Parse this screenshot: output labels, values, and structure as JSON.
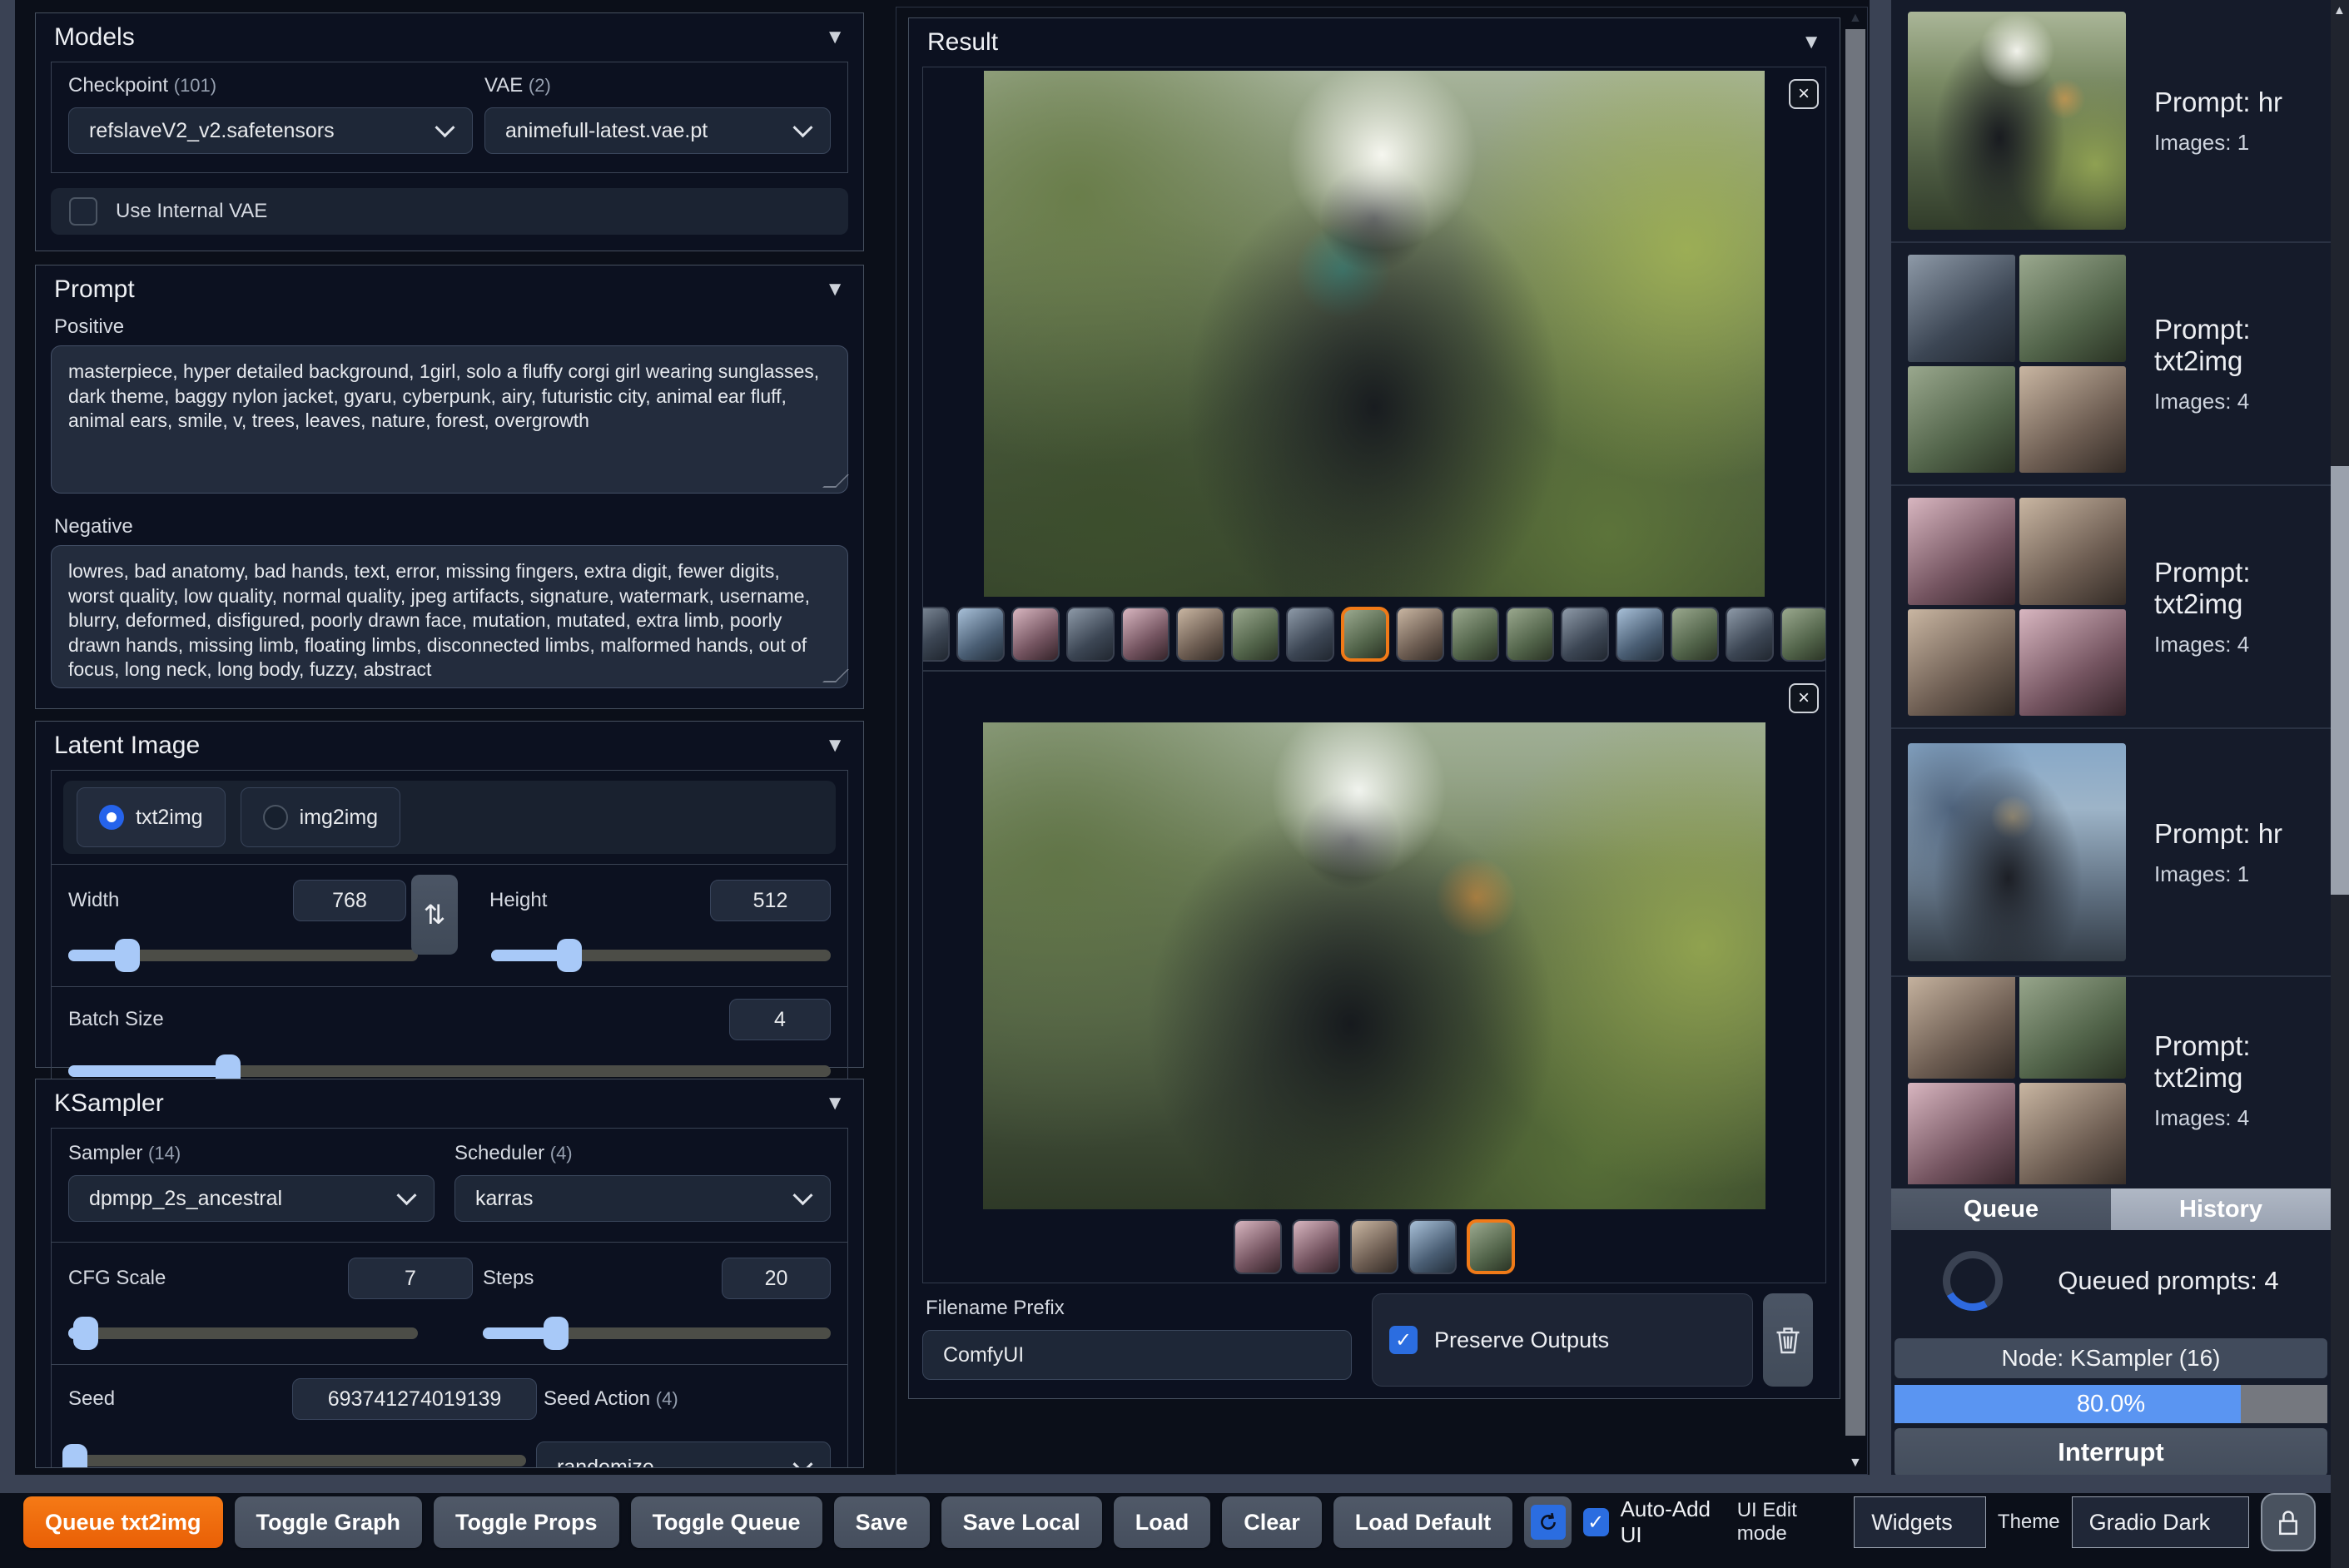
{
  "icons": {
    "collapse": "▼",
    "close": "×",
    "swap": "⇅",
    "check": "✓",
    "up_arrow": "▲",
    "down_arrow": "▼"
  },
  "colors": {
    "accent_orange": "#f07a18",
    "accent_blue": "#2b6de0",
    "slider_blue": "#a8c9f8",
    "progress_blue": "#5a95f2"
  },
  "left_panel": {
    "models": {
      "title": "Models",
      "checkpoint_label": "Checkpoint",
      "checkpoint_count": "(101)",
      "checkpoint_value": "refslaveV2_v2.safetensors",
      "vae_label": "VAE",
      "vae_count": "(2)",
      "vae_value": "animefull-latest.vae.pt",
      "use_internal_vae_label": "Use Internal VAE",
      "use_internal_vae_checked": false
    },
    "prompt": {
      "title": "Prompt",
      "positive_label": "Positive",
      "positive_value": "masterpiece, hyper detailed background, 1girl, solo a fluffy corgi girl wearing sunglasses, dark theme, baggy nylon jacket, gyaru, cyberpunk, airy, futuristic city, animal ear fluff, animal ears, smile, v, trees, leaves, nature, forest, overgrowth",
      "negative_label": "Negative",
      "negative_value": "lowres, bad anatomy, bad hands, text, error, missing fingers, extra digit, fewer digits, worst quality, low quality, normal quality, jpeg artifacts, signature, watermark, username, blurry, deformed, disfigured, poorly drawn face, mutation, mutated, extra limb, poorly drawn hands, missing limb, floating limbs, disconnected limbs, malformed hands, out of focus, long neck, long body, fuzzy, abstract"
    },
    "latent": {
      "title": "Latent Image",
      "mode_txt2img": "txt2img",
      "mode_img2img": "img2img",
      "mode_selected": "txt2img",
      "width_label": "Width",
      "width_value": "768",
      "height_label": "Height",
      "height_value": "512",
      "batch_label": "Batch Size",
      "batch_value": "4"
    },
    "ksampler": {
      "title": "KSampler",
      "sampler_label": "Sampler",
      "sampler_count": "(14)",
      "sampler_value": "dpmpp_2s_ancestral",
      "scheduler_label": "Scheduler",
      "scheduler_count": "(4)",
      "scheduler_value": "karras",
      "cfg_label": "CFG Scale",
      "cfg_value": "7",
      "steps_label": "Steps",
      "steps_value": "20",
      "seed_label": "Seed",
      "seed_value": "693741274019139",
      "seed_action_label": "Seed Action",
      "seed_action_count": "(4)",
      "seed_action_value": "randomize"
    }
  },
  "result_panel": {
    "title": "Result",
    "gallery1_thumb_count": 18,
    "gallery1_selected_index": 8,
    "gallery2_thumb_count": 5,
    "gallery2_selected_index": 4,
    "filename_prefix_label": "Filename Prefix",
    "filename_prefix_value": "ComfyUI",
    "preserve_outputs_label": "Preserve Outputs",
    "preserve_outputs_checked": true
  },
  "sidebar": {
    "items": [
      {
        "prompt": "Prompt: hr",
        "images": "Images: 1"
      },
      {
        "prompt": "Prompt: txt2img",
        "images": "Images: 4"
      },
      {
        "prompt": "Prompt: txt2img",
        "images": "Images: 4"
      },
      {
        "prompt": "Prompt: hr",
        "images": "Images: 1"
      },
      {
        "prompt": "Prompt: txt2img",
        "images": "Images: 4"
      }
    ],
    "tabs": {
      "queue_label": "Queue",
      "history_label": "History",
      "selected": "History"
    },
    "queued_text": "Queued prompts: 4",
    "node_text": "Node: KSampler (16)",
    "progress_text": "80.0%",
    "progress_percent": 80,
    "interrupt_label": "Interrupt"
  },
  "toolbar": {
    "queue_button": "Queue txt2img",
    "buttons": [
      "Toggle Graph",
      "Toggle Props",
      "Toggle Queue",
      "Save",
      "Save Local",
      "Load",
      "Clear",
      "Load Default"
    ],
    "auto_add_label": "Auto-Add UI",
    "auto_add_checked": true,
    "ui_edit_label": "UI Edit mode",
    "widgets_value": "Widgets",
    "theme_label": "Theme",
    "theme_value": "Gradio Dark"
  }
}
